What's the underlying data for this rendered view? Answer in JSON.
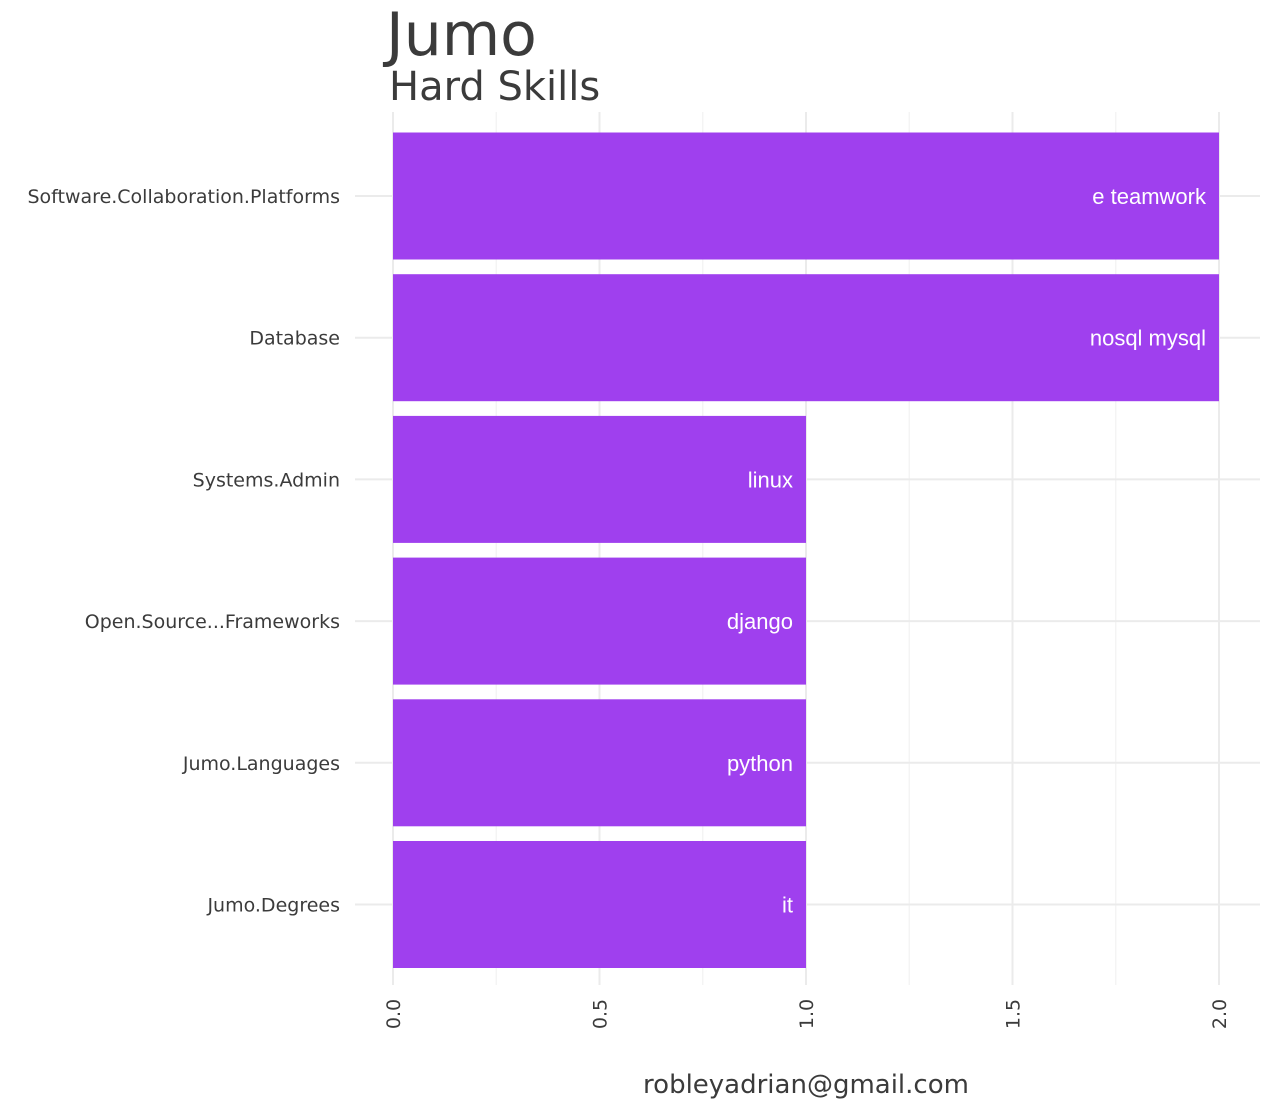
{
  "chart_data": {
    "type": "bar",
    "orientation": "horizontal",
    "title": "Jumo",
    "subtitle": "Hard Skills",
    "xlabel": "robleyadrian@gmail.com",
    "ylabel": "",
    "categories": [
      "Software.Collaboration.Platforms",
      "Database",
      "Systems.Admin",
      "Open.Source...Frameworks",
      "Jumo.Languages",
      "Jumo.Degrees"
    ],
    "values": [
      2,
      2,
      1,
      1,
      1,
      1
    ],
    "bar_labels": [
      "e teamwork",
      "nosql mysql",
      "linux",
      "django",
      "python",
      "it"
    ],
    "xlim": [
      0,
      2
    ],
    "xticks": [
      "0.0",
      "0.5",
      "1.0",
      "1.5",
      "2.0"
    ],
    "tick_label_rotation": "vertical",
    "grid": true,
    "legend": "none",
    "bar_color": "#9f40ee"
  }
}
